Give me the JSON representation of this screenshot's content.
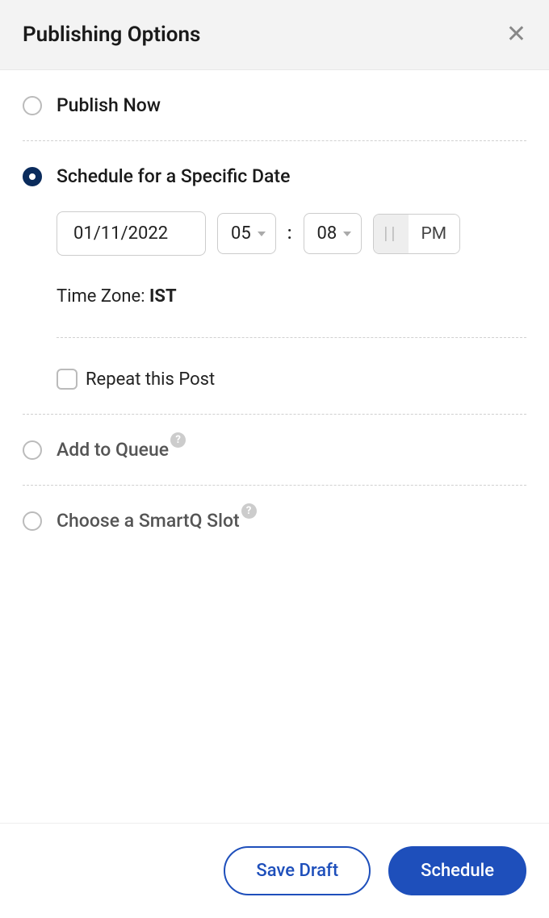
{
  "header": {
    "title": "Publishing Options"
  },
  "options": {
    "publish_now": {
      "label": "Publish Now",
      "selected": false
    },
    "schedule": {
      "label": "Schedule for a Specific Date",
      "selected": true,
      "date": "01/11/2022",
      "hour": "05",
      "minute": "08",
      "ampm_inactive": "||",
      "ampm_active": "PM",
      "timezone_label": "Time Zone: ",
      "timezone_value": "IST",
      "repeat": {
        "label": "Repeat this Post",
        "checked": false
      }
    },
    "queue": {
      "label": "Add to Queue",
      "selected": false
    },
    "smartq": {
      "label": "Choose a SmartQ Slot",
      "selected": false
    }
  },
  "footer": {
    "save_draft": "Save Draft",
    "schedule": "Schedule"
  }
}
